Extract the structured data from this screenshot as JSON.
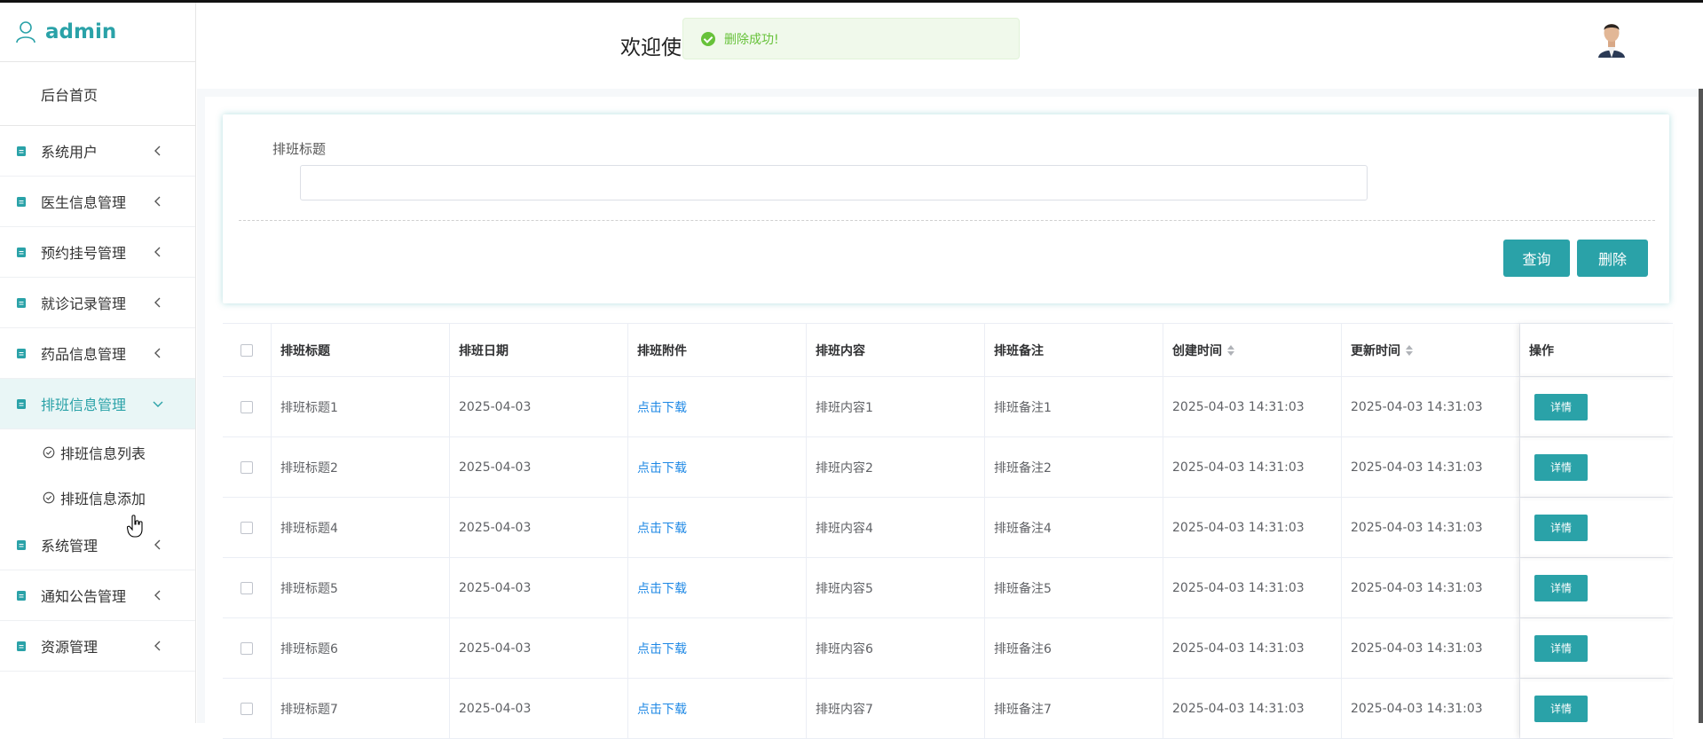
{
  "sidebar": {
    "brand": "admin",
    "home": "后台首页",
    "items": [
      {
        "label": "系统用户"
      },
      {
        "label": "医生信息管理"
      },
      {
        "label": "预约挂号管理"
      },
      {
        "label": "就诊记录管理"
      },
      {
        "label": "药品信息管理"
      },
      {
        "label": "排班信息管理"
      },
      {
        "label": "系统管理"
      },
      {
        "label": "通知公告管理"
      },
      {
        "label": "资源管理"
      }
    ],
    "subitems": [
      {
        "label": "排班信息列表"
      },
      {
        "label": "排班信息添加"
      }
    ]
  },
  "header": {
    "welcome": "欢迎使",
    "toast": "删除成功!"
  },
  "search": {
    "label": "排班标题",
    "value": "",
    "query_button": "查询",
    "delete_button": "删除"
  },
  "table": {
    "columns": [
      "排班标题",
      "排班日期",
      "排班附件",
      "排班内容",
      "排班备注",
      "创建时间",
      "更新时间",
      "操作"
    ],
    "rows": [
      [
        "排班标题1",
        "2025-04-03",
        "点击下载",
        "排班内容1",
        "排班备注1",
        "2025-04-03 14:31:03",
        "2025-04-03 14:31:03",
        "详情"
      ],
      [
        "排班标题2",
        "2025-04-03",
        "点击下载",
        "排班内容2",
        "排班备注2",
        "2025-04-03 14:31:03",
        "2025-04-03 14:31:03",
        "详情"
      ],
      [
        "排班标题4",
        "2025-04-03",
        "点击下载",
        "排班内容4",
        "排班备注4",
        "2025-04-03 14:31:03",
        "2025-04-03 14:31:03",
        "详情"
      ],
      [
        "排班标题5",
        "2025-04-03",
        "点击下载",
        "排班内容5",
        "排班备注5",
        "2025-04-03 14:31:03",
        "2025-04-03 14:31:03",
        "详情"
      ],
      [
        "排班标题6",
        "2025-04-03",
        "点击下载",
        "排班内容6",
        "排班备注6",
        "2025-04-03 14:31:03",
        "2025-04-03 14:31:03",
        "详情"
      ],
      [
        "排班标题7",
        "2025-04-03",
        "点击下载",
        "排班内容7",
        "排班备注7",
        "2025-04-03 14:31:03",
        "2025-04-03 14:31:03",
        "详情"
      ]
    ]
  },
  "colors": {
    "accent": "#2aa2a8",
    "toast_bg": "#f0f9eb",
    "toast_text": "#67c23a",
    "link": "#1e88e5"
  }
}
